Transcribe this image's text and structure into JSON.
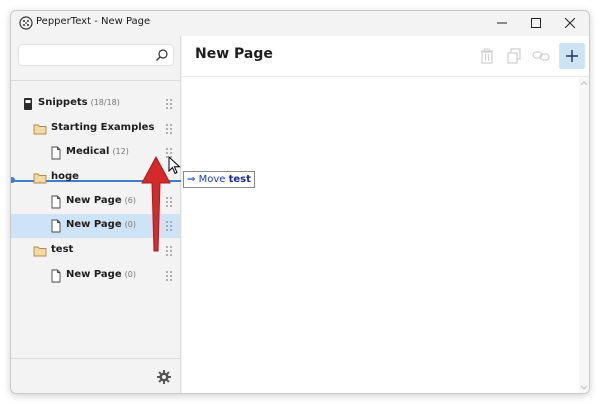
{
  "window": {
    "title": "PepperText - New Page",
    "controls": [
      "minimize-icon",
      "maximize-icon",
      "close-icon"
    ]
  },
  "sidebar": {
    "search": {
      "value": "",
      "placeholder": ""
    },
    "tree": [
      {
        "label": "Snippets",
        "count": "(18/18)",
        "icon": "device-icon",
        "level": 0,
        "selected": false
      },
      {
        "label": "Starting Examples",
        "count": "",
        "icon": "folder-icon",
        "level": 1,
        "selected": false
      },
      {
        "label": "Medical",
        "count": "(12)",
        "icon": "page-icon",
        "level": 2,
        "selected": false
      },
      {
        "label": "hoge",
        "count": "",
        "icon": "folder-icon",
        "level": 1,
        "selected": false
      },
      {
        "label": "New Page",
        "count": "(6)",
        "icon": "page-icon",
        "level": 2,
        "selected": false
      },
      {
        "label": "New Page",
        "count": "(0)",
        "icon": "page-icon",
        "level": 2,
        "selected": true
      },
      {
        "label": "test",
        "count": "",
        "icon": "folder-icon",
        "level": 1,
        "selected": false
      },
      {
        "label": "New Page",
        "count": "(0)",
        "icon": "page-icon",
        "level": 2,
        "selected": false
      }
    ],
    "footer_icon": "gear-icon"
  },
  "main": {
    "page_title": "New Page",
    "toolbar_icons": [
      "trash-icon",
      "copy-icon",
      "link-icon",
      "plus-icon"
    ],
    "editor_content": ""
  },
  "drag": {
    "tooltip_arrow": "⇒",
    "tooltip_action": "Move",
    "tooltip_target": "test"
  },
  "colors": {
    "accent": "#3f7cc9",
    "selection": "#cfe3f7",
    "annotation_arrow": "#d42a2a",
    "folder": "#c9a15a"
  }
}
